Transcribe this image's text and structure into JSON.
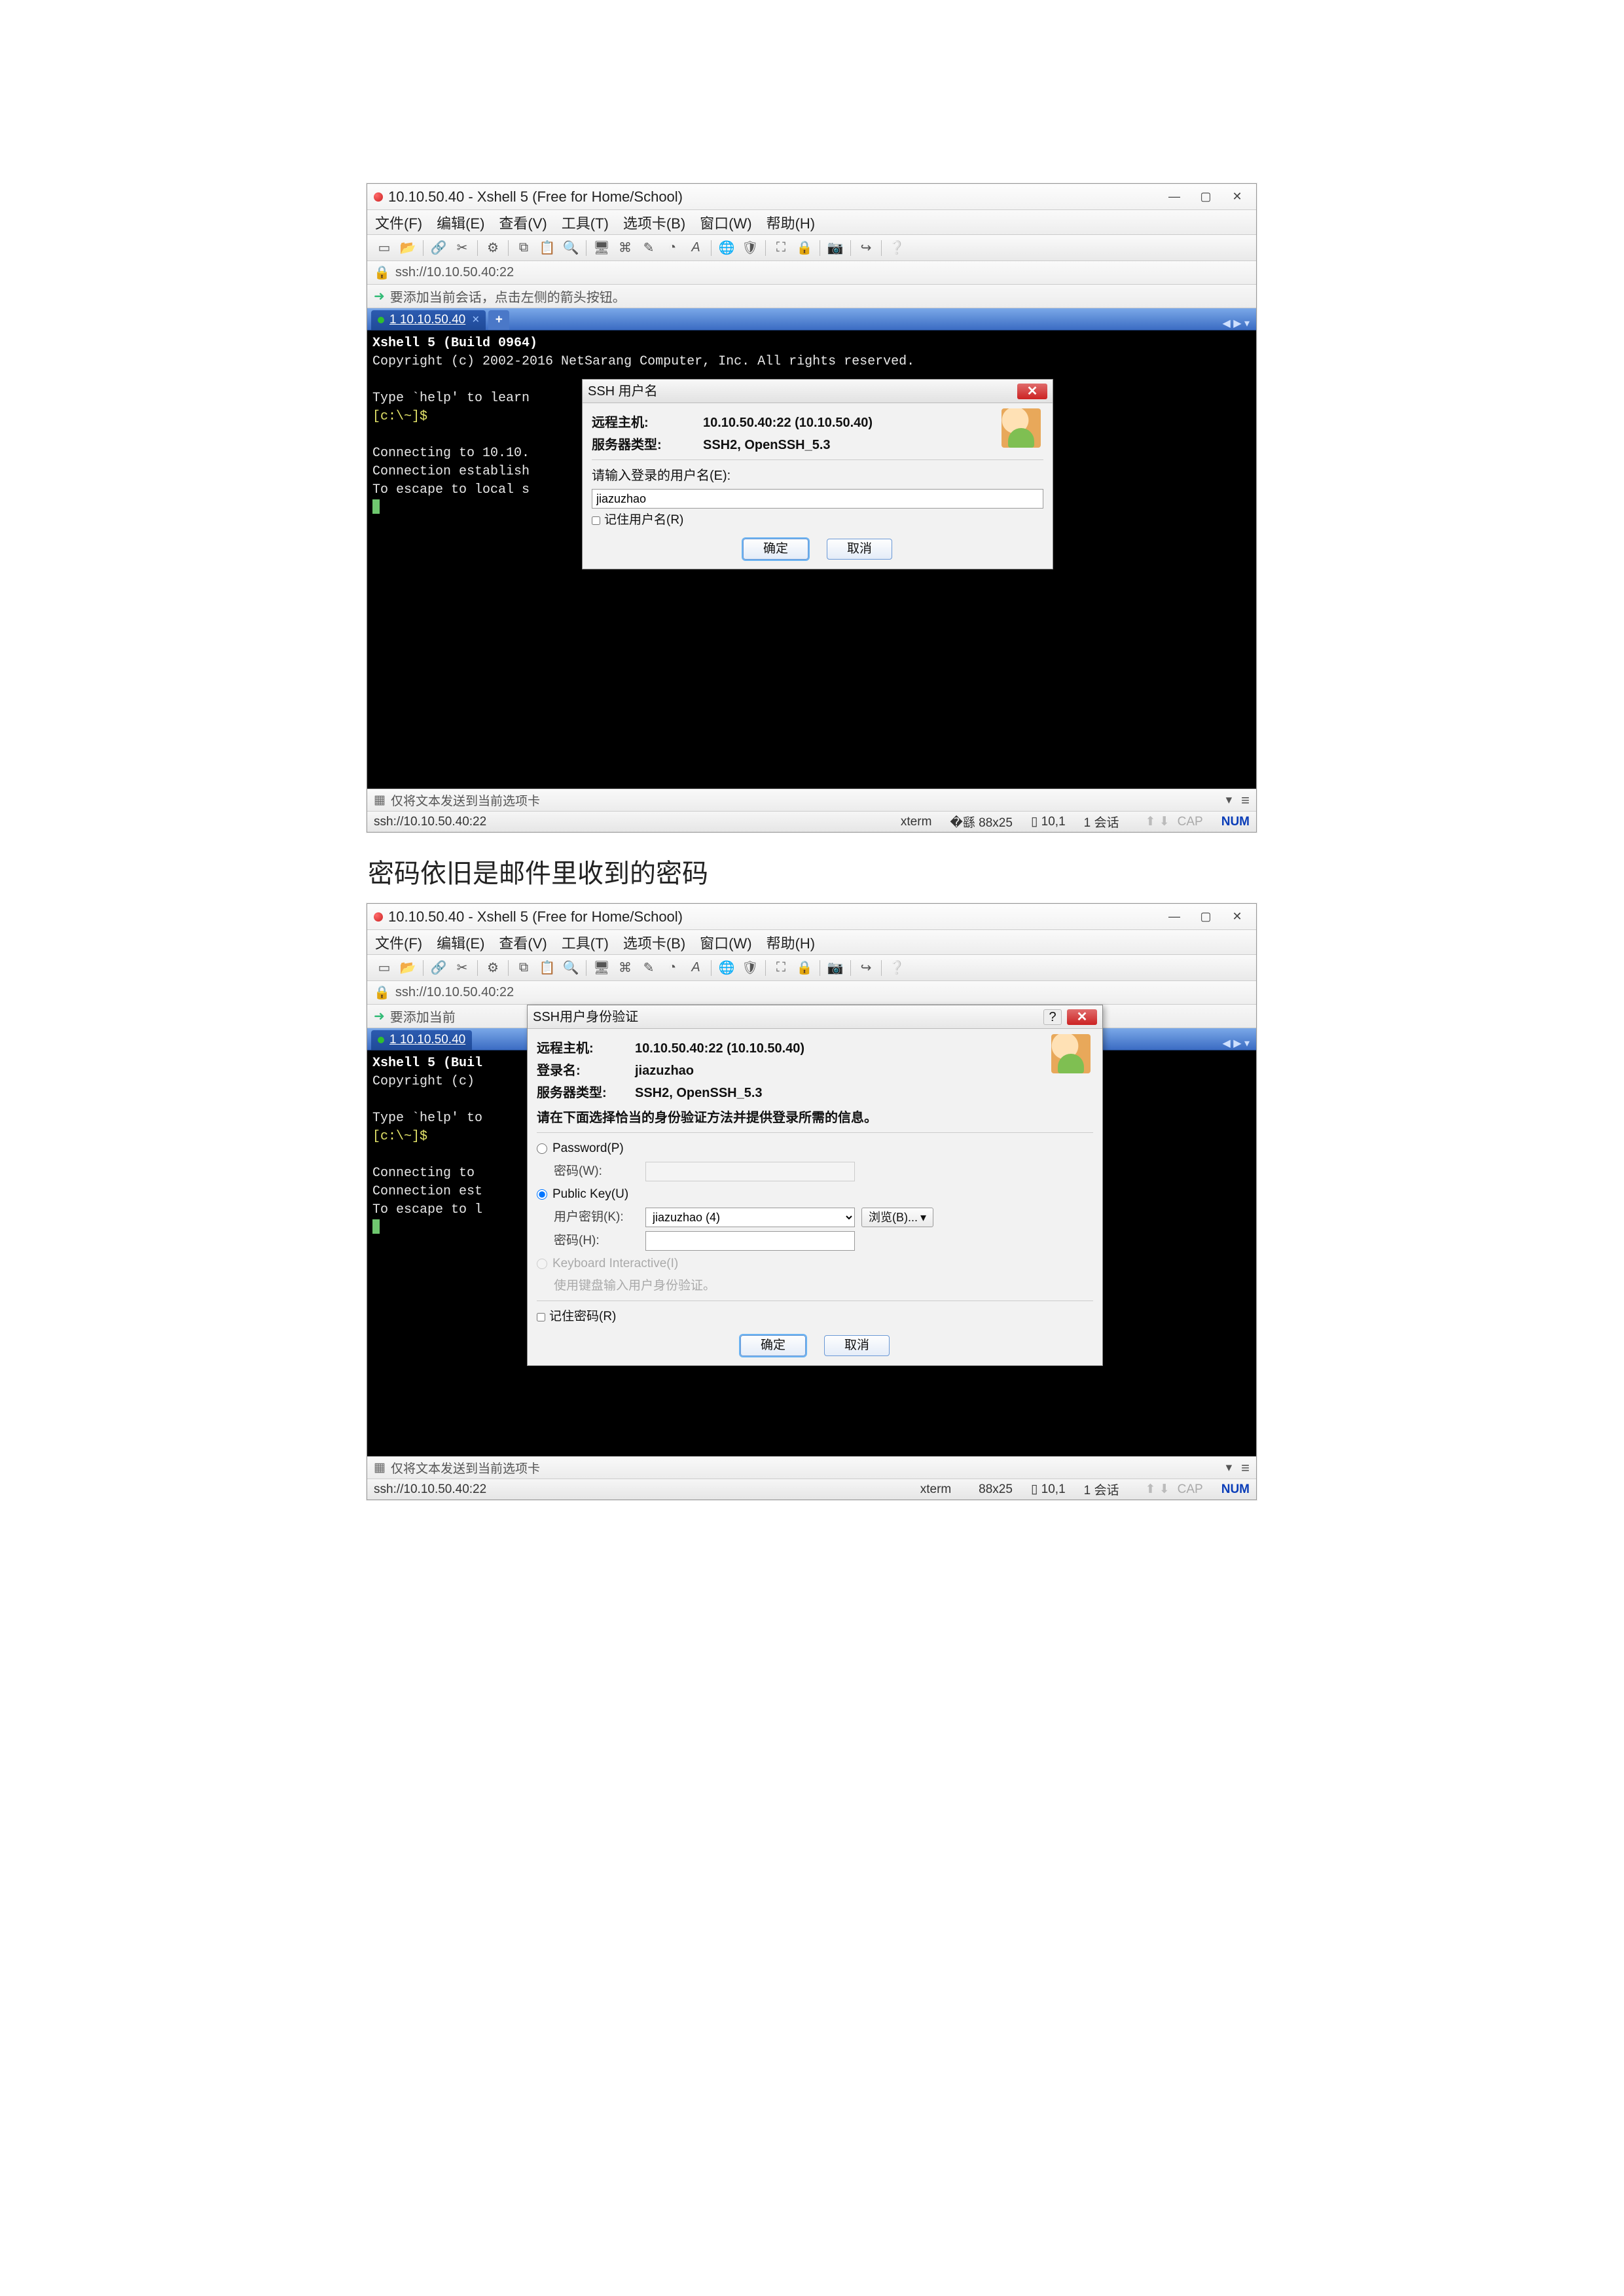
{
  "caption_between": "密码依旧是邮件里收到的密码",
  "shot1": {
    "title": "10.10.50.40 - Xshell 5 (Free for Home/School)",
    "menu": [
      "文件(F)",
      "编辑(E)",
      "查看(V)",
      "工具(T)",
      "选项卡(B)",
      "窗口(W)",
      "帮助(H)"
    ],
    "address": "ssh://10.10.50.40:22",
    "hint": "要添加当前会话，点击左侧的箭头按钮。",
    "tabs": {
      "active": "1 10.10.50.40",
      "add": "+"
    },
    "terminal_lines": [
      {
        "cls": "bold",
        "text": "Xshell 5 (Build 0964)"
      },
      {
        "cls": "white",
        "text": "Copyright (c) 2002-2016 NetSarang Computer, Inc. All rights reserved."
      },
      {
        "cls": "",
        "text": ""
      },
      {
        "cls": "white",
        "text": "Type `help' to learn"
      },
      {
        "cls": "yellow",
        "text": "[c:\\~]$"
      },
      {
        "cls": "",
        "text": ""
      },
      {
        "cls": "white",
        "text": "Connecting to 10.10."
      },
      {
        "cls": "white",
        "text": "Connection establish"
      },
      {
        "cls": "white",
        "text": "To escape to local s"
      },
      {
        "cls": "cursor",
        "text": ""
      }
    ],
    "dialog": {
      "title": "SSH 用户名",
      "rows": [
        {
          "label": "远程主机:",
          "value": "10.10.50.40:22 (10.10.50.40)"
        },
        {
          "label": "服务器类型:",
          "value": "SSH2, OpenSSH_5.3"
        }
      ],
      "prompt": "请输入登录的用户名(E):",
      "username": "jiazuzhao",
      "remember": "记住用户名(R)",
      "ok": "确定",
      "cancel": "取消"
    },
    "sendbar": "仅将文本发送到当前选项卡",
    "status": {
      "addr": "ssh://10.10.50.40:22",
      "term": "xterm",
      "size": "88x25",
      "pos": "10,1",
      "sess": "1 会话",
      "cap": "CAP",
      "num": "NUM"
    }
  },
  "shot2": {
    "title": "10.10.50.40 - Xshell 5 (Free for Home/School)",
    "menu": [
      "文件(F)",
      "编辑(E)",
      "查看(V)",
      "工具(T)",
      "选项卡(B)",
      "窗口(W)",
      "帮助(H)"
    ],
    "address": "ssh://10.10.50.40:22",
    "hint": "要添加当前",
    "tabs": {
      "active": "1 10.10.50.40"
    },
    "terminal_lines": [
      {
        "cls": "bold",
        "text": "Xshell 5 (Buil"
      },
      {
        "cls": "white",
        "text": "Copyright (c)"
      },
      {
        "cls": "",
        "text": ""
      },
      {
        "cls": "white",
        "text": "Type `help' to"
      },
      {
        "cls": "yellow",
        "text": "[c:\\~]$"
      },
      {
        "cls": "",
        "text": ""
      },
      {
        "cls": "white",
        "text": "Connecting to"
      },
      {
        "cls": "white",
        "text": "Connection est"
      },
      {
        "cls": "white",
        "text": "To escape to l"
      },
      {
        "cls": "cursor",
        "text": ""
      }
    ],
    "dialog": {
      "title": "SSH用户身份验证",
      "rows": [
        {
          "label": "远程主机:",
          "value": "10.10.50.40:22 (10.10.50.40)"
        },
        {
          "label": "登录名:",
          "value": "jiazuzhao"
        },
        {
          "label": "服务器类型:",
          "value": "SSH2, OpenSSH_5.3"
        }
      ],
      "instruction": "请在下面选择恰当的身份验证方法并提供登录所需的信息。",
      "opt_password": "Password(P)",
      "password_label": "密码(W):",
      "opt_publickey": "Public Key(U)",
      "userkey_label": "用户密钥(K):",
      "userkey_value": "jiazuzhao (4)",
      "browse": "浏览(B)...",
      "passphrase_label": "密码(H):",
      "opt_kbd": "Keyboard Interactive(I)",
      "kbd_note": "使用键盘输入用户身份验证。",
      "remember": "记住密码(R)",
      "ok": "确定",
      "cancel": "取消"
    },
    "sendbar": "仅将文本发送到当前选项卡",
    "status": {
      "addr": "ssh://10.10.50.40:22",
      "term": "xterm",
      "size": "88x25",
      "pos": "10,1",
      "sess": "1 会话",
      "cap": "CAP",
      "num": "NUM"
    }
  }
}
